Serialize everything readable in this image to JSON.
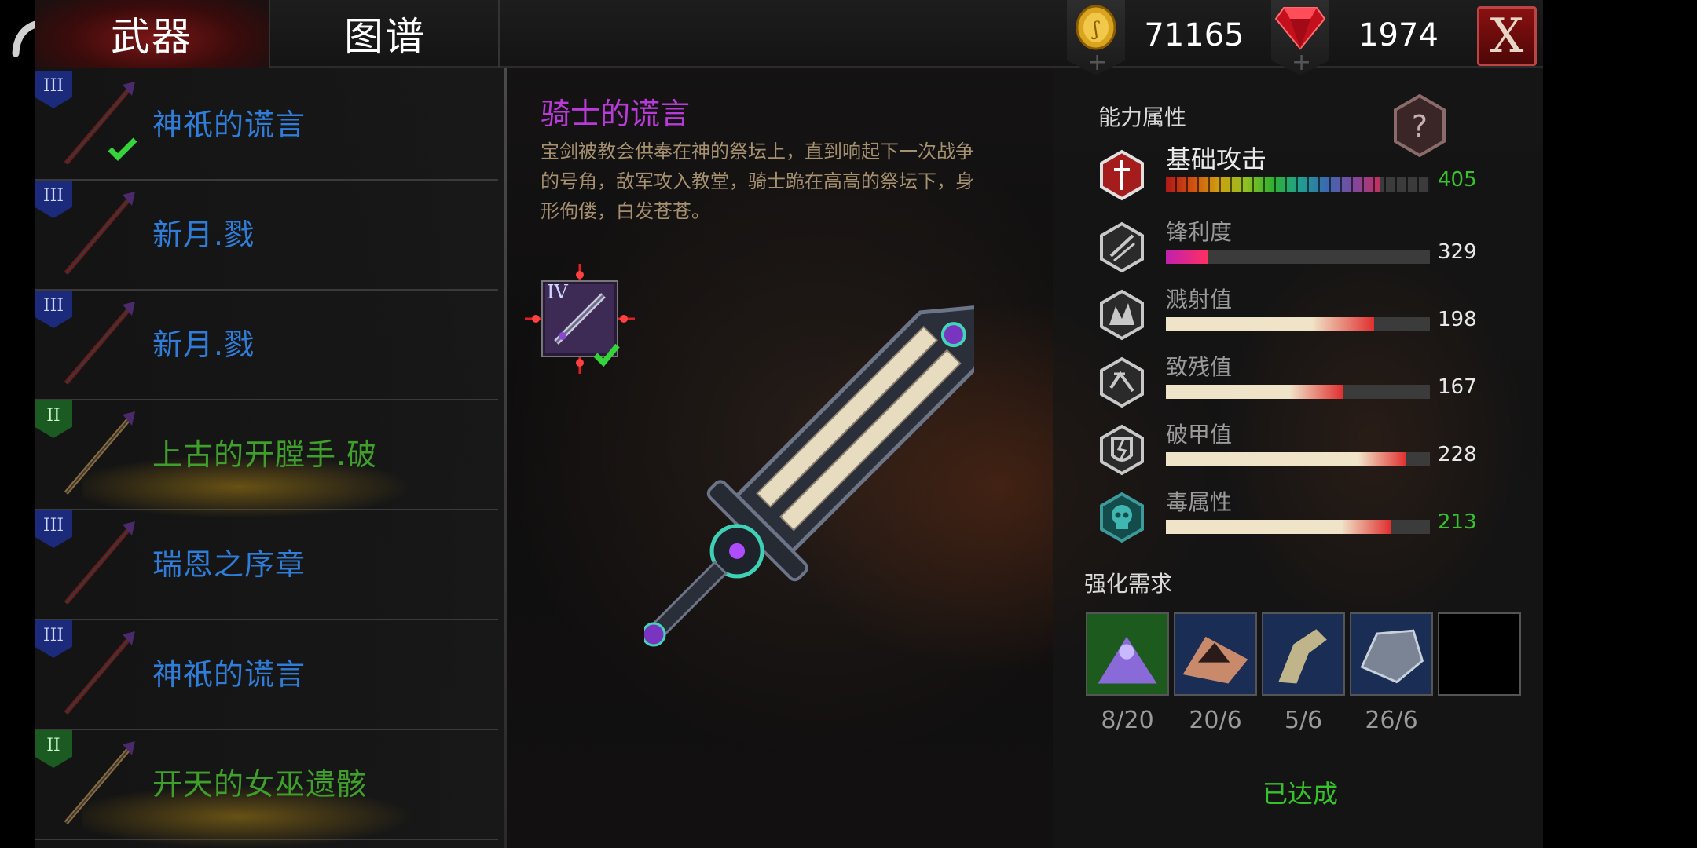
{
  "tabs": {
    "weapons": "武器",
    "atlas": "图谱"
  },
  "currency": {
    "gold": "71165",
    "gems": "1974"
  },
  "close_label": "X",
  "weapon_list": [
    {
      "tier": "III",
      "name": "神祇的谎言",
      "rarity": "blue",
      "equipped": true
    },
    {
      "tier": "III",
      "name": "新月.戮",
      "rarity": "blue",
      "equipped": false
    },
    {
      "tier": "III",
      "name": "新月.戮",
      "rarity": "blue",
      "equipped": false
    },
    {
      "tier": "II",
      "name": "上古的开膛手.破",
      "rarity": "green",
      "equipped": false
    },
    {
      "tier": "III",
      "name": "瑞恩之序章",
      "rarity": "blue",
      "equipped": false
    },
    {
      "tier": "III",
      "name": "神祇的谎言",
      "rarity": "blue",
      "equipped": false
    },
    {
      "tier": "II",
      "name": "开天的女巫遗骸",
      "rarity": "green",
      "equipped": false
    }
  ],
  "selected_item": {
    "title": "骑士的谎言",
    "description": "宝剑被教会供奉在神的祭坛上，直到响起下一次战争的号角，敌军攻入教堂，骑士跪在高高的祭坛下，身形佝偻，白发苍苍。",
    "tier": "IV"
  },
  "stats_section": {
    "title": "能力属性",
    "stats": [
      {
        "name": "基础攻击",
        "value": "405",
        "fill": 0.81,
        "icon": "attack-icon",
        "value_color": "#36c22b"
      },
      {
        "name": "锋利度",
        "value": "329",
        "fill": 0.16,
        "icon": "sharpness-icon",
        "value_color": "#e8e8e8"
      },
      {
        "name": "溅射值",
        "value": "198",
        "fill": 0.79,
        "icon": "splash-icon",
        "value_color": "#e8e8e8"
      },
      {
        "name": "致残值",
        "value": "167",
        "fill": 0.67,
        "icon": "cripple-icon",
        "value_color": "#e8e8e8"
      },
      {
        "name": "破甲值",
        "value": "228",
        "fill": 0.91,
        "icon": "armor-break-icon",
        "value_color": "#e8e8e8"
      },
      {
        "name": "毒属性",
        "value": "213",
        "fill": 0.85,
        "icon": "poison-skull-icon",
        "value_color": "#36c22b"
      }
    ]
  },
  "requirements": {
    "title": "强化需求",
    "items": [
      {
        "icon": "purple-dust-icon",
        "count": "8/20"
      },
      {
        "icon": "red-ore-icon",
        "count": "20/6"
      },
      {
        "icon": "bone-claw-icon",
        "count": "5/6"
      },
      {
        "icon": "dark-stone-icon",
        "count": "26/6"
      },
      {
        "icon": "empty-slot",
        "count": ""
      }
    ],
    "status": "已达成"
  },
  "colors": {
    "accent_red": "#7a1616",
    "list_blue": "#2f7dd9",
    "list_green": "#3f9f2a",
    "title_purple": "#b83ad9",
    "ok_green": "#36c22b"
  }
}
